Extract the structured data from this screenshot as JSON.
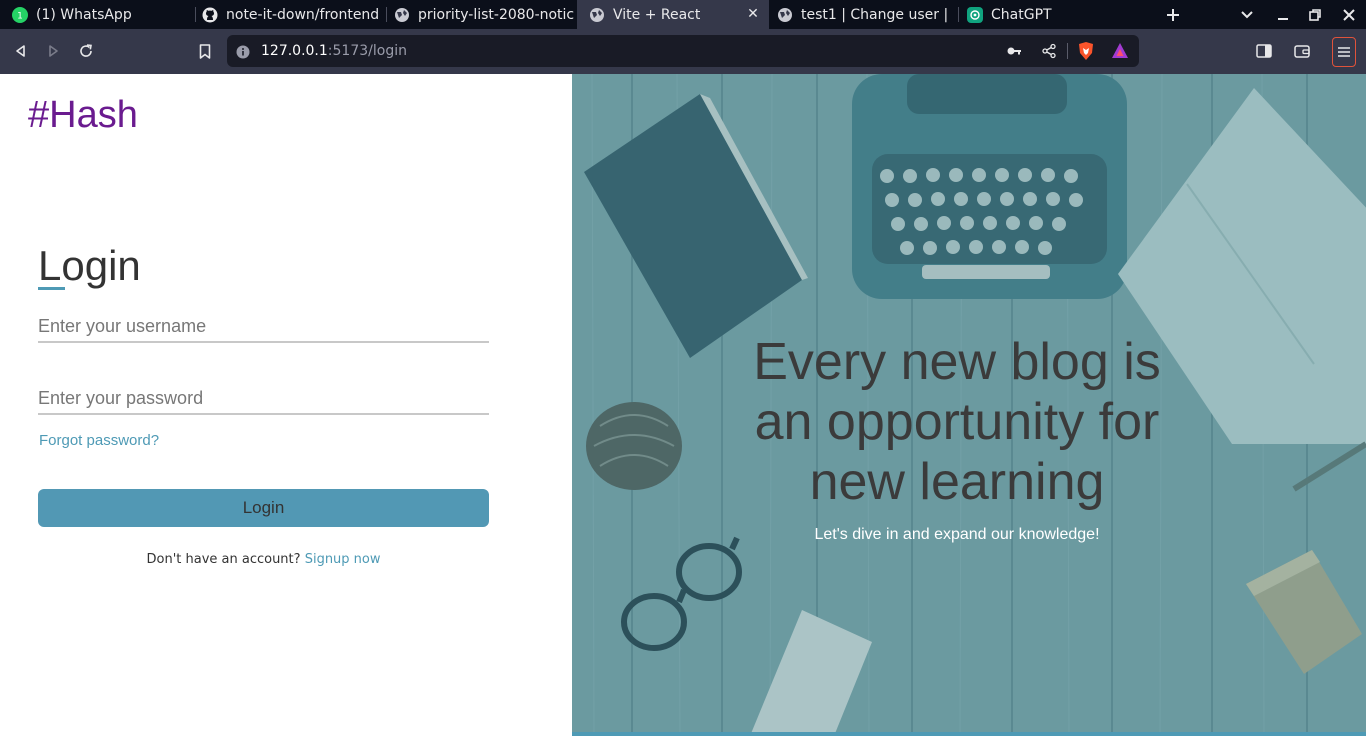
{
  "browser": {
    "tabs": [
      {
        "title": "(1) WhatsApp",
        "icon": "whatsapp-icon",
        "active": false
      },
      {
        "title": "note-it-down/frontend",
        "icon": "github-icon",
        "active": false
      },
      {
        "title": "priority-list-2080-notic",
        "icon": "globe-icon",
        "active": false
      },
      {
        "title": "Vite + React",
        "icon": "globe-icon",
        "active": true
      },
      {
        "title": "test1 | Change user |",
        "icon": "globe-icon",
        "active": false
      },
      {
        "title": "ChatGPT",
        "icon": "chatgpt-icon",
        "active": false
      }
    ],
    "url": {
      "host": "127.0.0.1",
      "path": ":5173/login"
    },
    "colors": {
      "tabstrip": "#0b0f1a",
      "toolbar": "#35384a",
      "urlbar": "#191b26",
      "menu_border": "#e0533b"
    }
  },
  "login": {
    "brand": "#Hash",
    "heading": "Login",
    "username_placeholder": "Enter your username",
    "password_placeholder": "Enter your password",
    "forgot": "Forgot password?",
    "button": "Login",
    "signup_prompt": "Don't have an account?",
    "signup_link": "Signup now",
    "colors": {
      "brand": "#6a1b8f",
      "accent": "#4e9ab5",
      "button": "#5298b4"
    }
  },
  "hero": {
    "tagline_line1": "Every new blog is",
    "tagline_line2": "an opportunity for",
    "tagline_line3": "new learning",
    "subline": "Let's dive in and expand our knowledge!",
    "colors": {
      "overlay": "#6e9aa0",
      "tagline": "#3b3b3b",
      "subline": "#ffffff"
    }
  }
}
